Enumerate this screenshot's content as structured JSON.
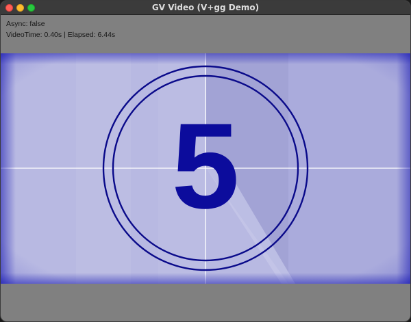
{
  "window": {
    "title": "GV Video (V+gg Demo)"
  },
  "status": {
    "async_line": "Async: false",
    "timing_line": "VideoTime: 0.40s | Elapsed: 6.44s"
  },
  "video": {
    "countdown_number": "5",
    "colors": {
      "background": "#aaabdc",
      "wedge_light": "#bfc0e4",
      "wedge_dark": "#a3a4d6",
      "vignette": "#1010b8",
      "ring": "#0a0a8a",
      "digit": "#0c0c9c",
      "crosshair": "#ffffff"
    }
  }
}
